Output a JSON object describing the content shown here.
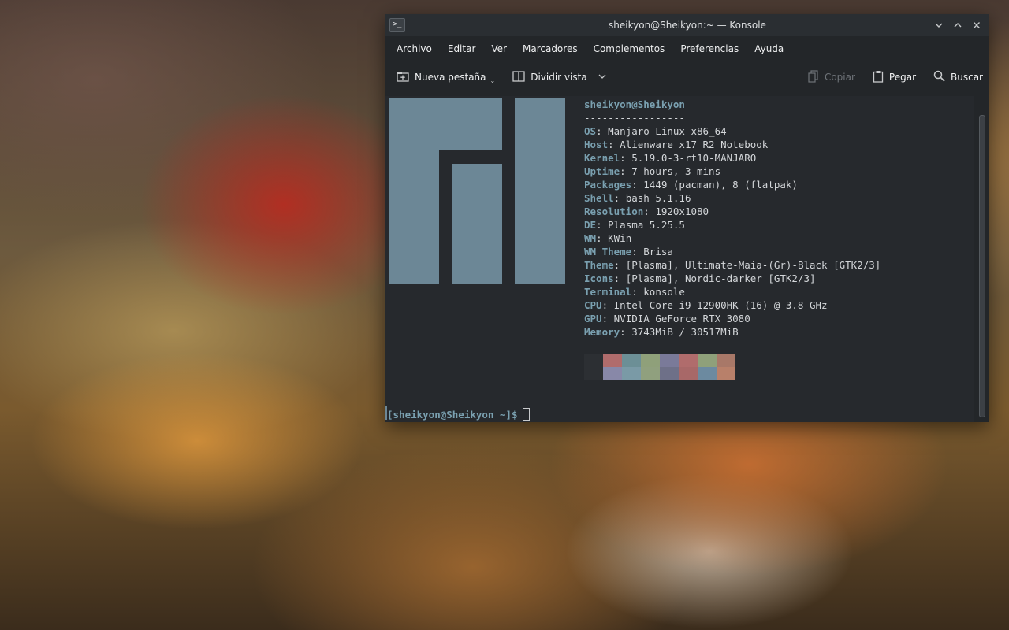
{
  "window": {
    "title": "sheikyon@Sheikyon:~ — Konsole",
    "app_icon_glyph": ">_",
    "controls": [
      "minimize",
      "maximize",
      "close"
    ]
  },
  "menubar": {
    "items": [
      "Archivo",
      "Editar",
      "Ver",
      "Marcadores",
      "Complementos",
      "Preferencias",
      "Ayuda"
    ]
  },
  "toolbar": {
    "new_tab": "Nueva pestaña",
    "split_view": "Dividir vista",
    "copy": "Copiar",
    "paste": "Pegar",
    "find": "Buscar"
  },
  "terminal": {
    "user_host": "sheikyon@Sheikyon",
    "separator": "-----------------",
    "info": [
      {
        "key": "OS",
        "value": "Manjaro Linux x86_64"
      },
      {
        "key": "Host",
        "value": "Alienware x17 R2 Notebook"
      },
      {
        "key": "Kernel",
        "value": "5.19.0-3-rt10-MANJARO"
      },
      {
        "key": "Uptime",
        "value": "7 hours, 3 mins"
      },
      {
        "key": "Packages",
        "value": "1449 (pacman), 8 (flatpak)"
      },
      {
        "key": "Shell",
        "value": "bash 5.1.16"
      },
      {
        "key": "Resolution",
        "value": "1920x1080"
      },
      {
        "key": "DE",
        "value": "Plasma 5.25.5"
      },
      {
        "key": "WM",
        "value": "KWin"
      },
      {
        "key": "WM Theme",
        "value": "Brisa"
      },
      {
        "key": "Theme",
        "value": "[Plasma], Ultimate-Maia-(Gr)-Black [GTK2/3]"
      },
      {
        "key": "Icons",
        "value": "[Plasma], Nordic-darker [GTK2/3]"
      },
      {
        "key": "Terminal",
        "value": "konsole"
      },
      {
        "key": "CPU",
        "value": "Intel Core i9-12900HK (16) @ 3.8 GHz"
      },
      {
        "key": "GPU",
        "value": "NVIDIA GeForce RTX 3080"
      },
      {
        "key": "Memory",
        "value": "3743MiB / 30517MiB"
      }
    ],
    "palette_top": [
      "#2c2f33",
      "#b06c6c",
      "#6c8f96",
      "#8fa07a",
      "#7a7a99",
      "#b06c6c",
      "#8fa07a",
      "#a87868"
    ],
    "palette_bottom": [
      "#2c2f33",
      "#8888a8",
      "#7a9aa6",
      "#90a07e",
      "#6e7088",
      "#a86868",
      "#6c8aa0",
      "#b8806a"
    ],
    "prompt": "[sheikyon@Sheikyon ~]$",
    "logo_color": "#6c8796"
  }
}
